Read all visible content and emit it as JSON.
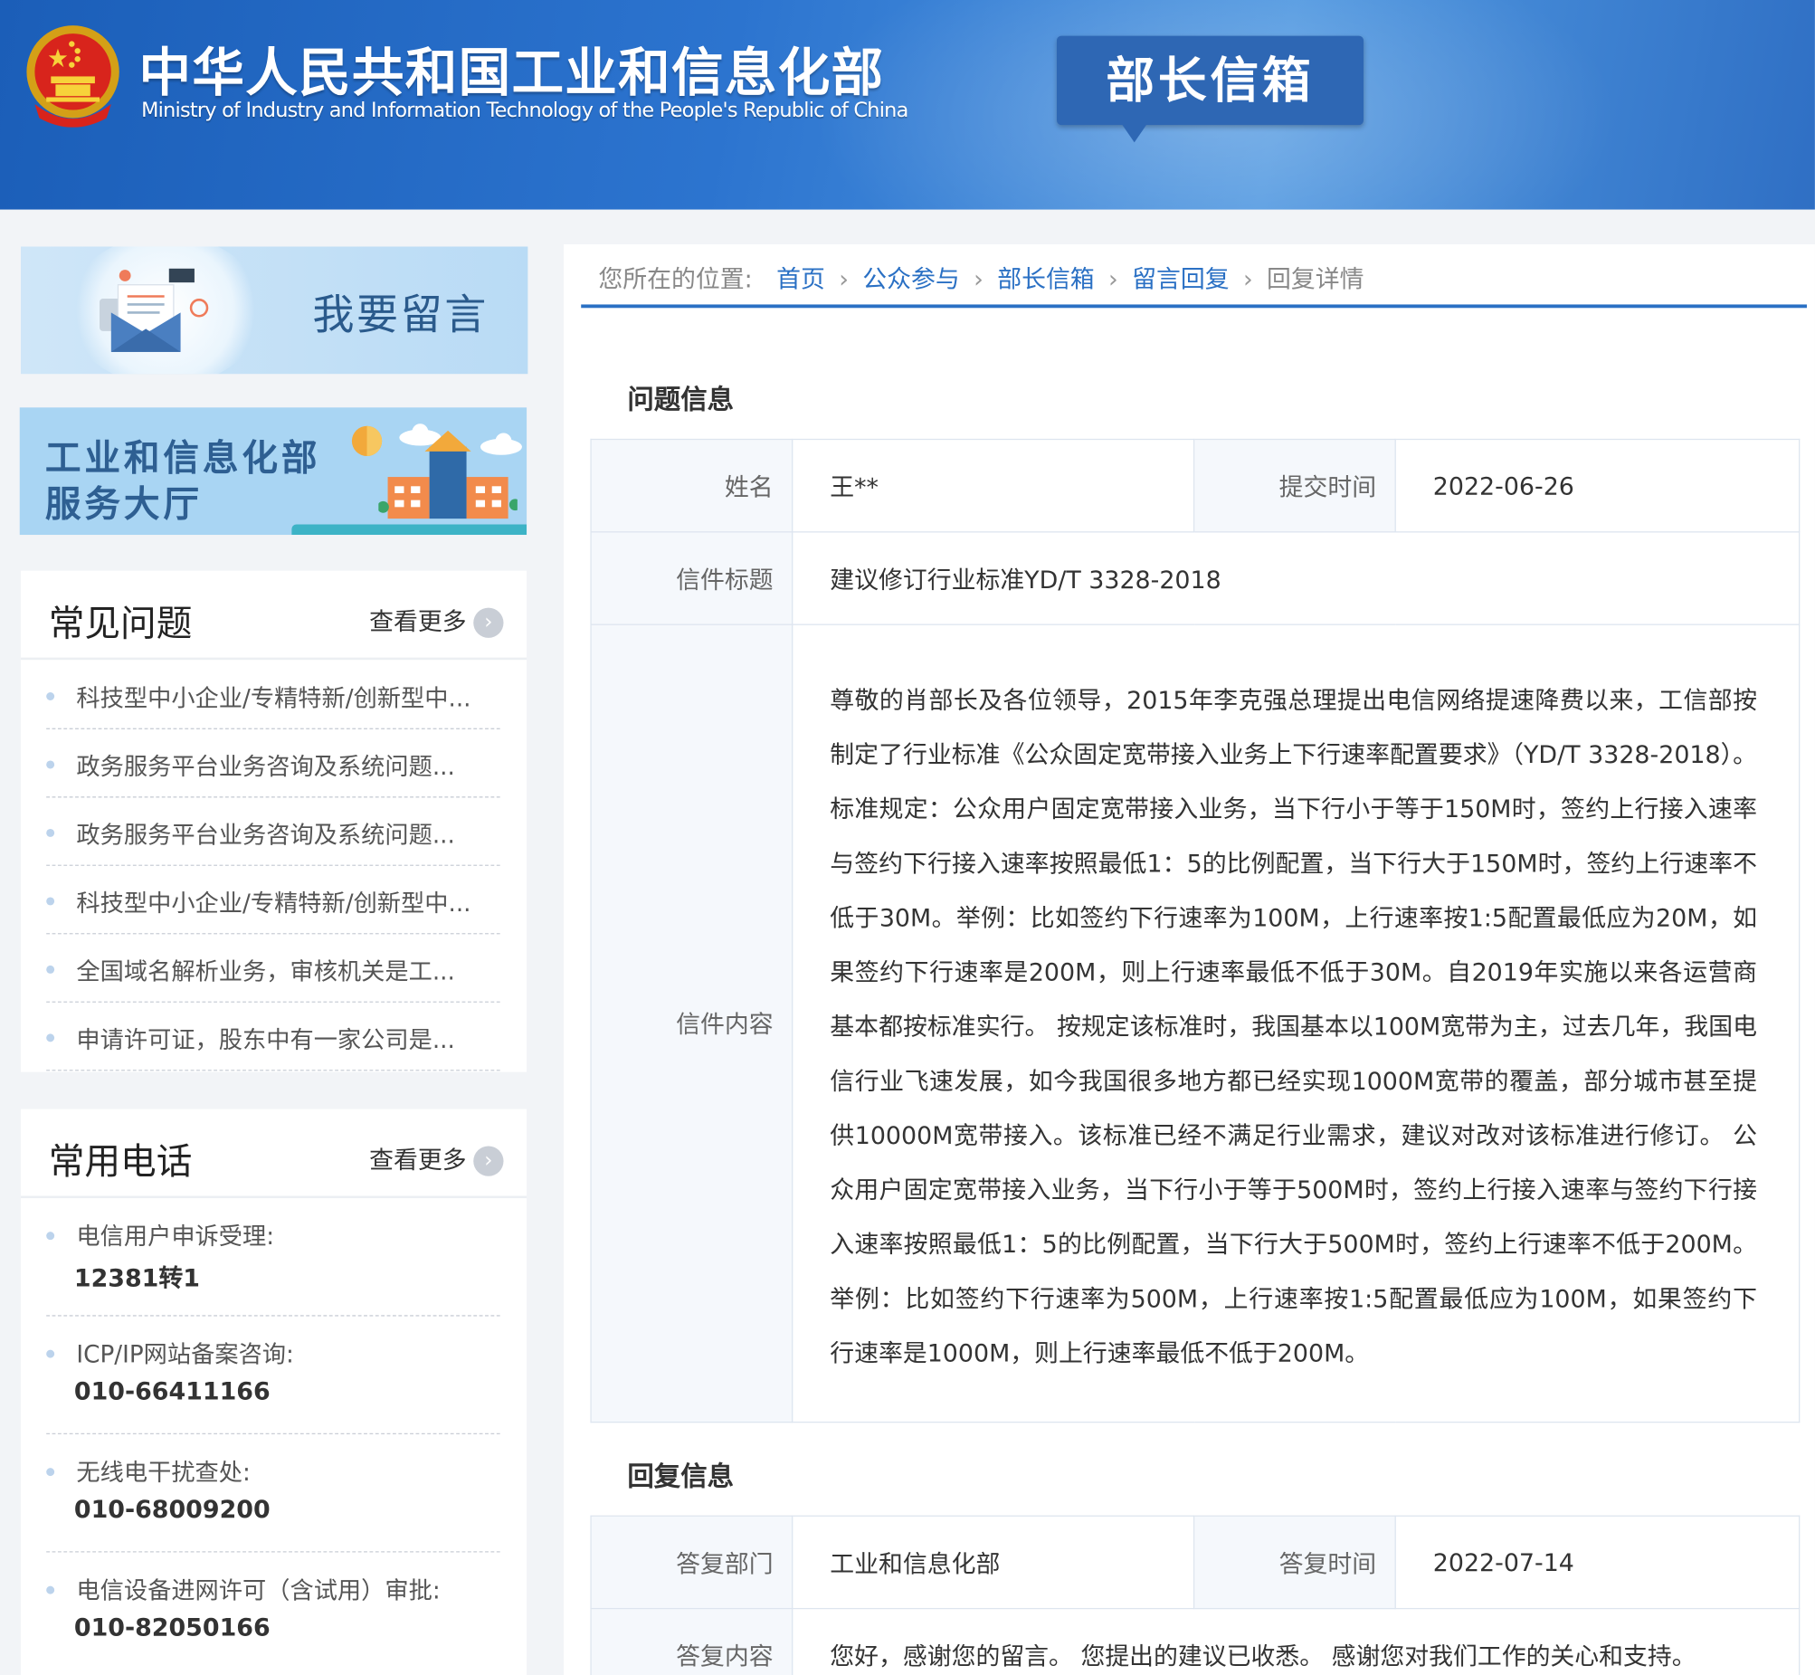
{
  "header": {
    "title_cn": "中华人民共和国工业和信息化部",
    "title_en": "Ministry of Industry and Information Technology of the People's Republic of China",
    "section_badge": "部长信箱"
  },
  "sidebar": {
    "leave_message": "我要留言",
    "service_hall_line1": "工业和信息化部",
    "service_hall_line2": "服务大厅",
    "faq": {
      "title": "常见问题",
      "more": "查看更多",
      "items": [
        "科技型中小企业/专精特新/创新型中...",
        "政务服务平台业务咨询及系统问题...",
        "政务服务平台业务咨询及系统问题...",
        "科技型中小企业/专精特新/创新型中...",
        "全国域名解析业务，审核机关是工...",
        "申请许可证，股东中有一家公司是..."
      ]
    },
    "phones": {
      "title": "常用电话",
      "more": "查看更多",
      "items": [
        {
          "label": "电信用户申诉受理:",
          "number": "12381转1"
        },
        {
          "label": "ICP/IP网站备案咨询:",
          "number": "010-66411166"
        },
        {
          "label": "无线电干扰查处:",
          "number": "010-68009200"
        },
        {
          "label": "电信设备进网许可（含试用）审批:",
          "number": "010-82050166"
        }
      ]
    }
  },
  "breadcrumb": {
    "prefix": "您所在的位置:",
    "items": [
      "首页",
      "公众参与",
      "部长信箱",
      "留言回复"
    ],
    "current": "回复详情"
  },
  "question": {
    "section_title": "问题信息",
    "name_label": "姓名",
    "name_value": "王**",
    "submit_label": "提交时间",
    "submit_value": "2022-06-26",
    "subject_label": "信件标题",
    "subject_value": "建议修订行业标准YD/T 3328-2018",
    "content_label": "信件内容",
    "content_value": "尊敬的肖部长及各位领导，2015年李克强总理提出电信网络提速降费以来，工信部按制定了行业标准《公众固定宽带接入业务上下行速率配置要求》（YD/T 3328-2018）。标准规定：公众用户固定宽带接入业务，当下行小于等于150M时，签约上行接入速率与签约下行接入速率按照最低1：5的比例配置，当下行大于150M时，签约上行速率不低于30M。举例：比如签约下行速率为100M，上行速率按1:5配置最低应为20M，如果签约下行速率是200M，则上行速率最低不低于30M。自2019年实施以来各运营商基本都按标准实行。 按规定该标准时，我国基本以100M宽带为主，过去几年，我国电信行业飞速发展，如今我国很多地方都已经实现1000M宽带的覆盖，部分城市甚至提供10000M宽带接入。该标准已经不满足行业需求，建议对改对该标准进行修订。 公众用户固定宽带接入业务，当下行小于等于500M时，签约上行接入速率与签约下行接入速率按照最低1：5的比例配置，当下行大于500M时，签约上行速率不低于200M。举例：比如签约下行速率为500M，上行速率按1:5配置最低应为100M，如果签约下行速率是1000M，则上行速率最低不低于200M。"
  },
  "reply": {
    "section_title": "回复信息",
    "dept_label": "答复部门",
    "dept_value": "工业和信息化部",
    "time_label": "答复时间",
    "time_value": "2022-07-14",
    "content_label": "答复内容",
    "content_value": "您好，感谢您的留言。 您提出的建议已收悉。 感谢您对我们工作的关心和支持。"
  },
  "colors": {
    "header_blue": "#2c74cf",
    "link_blue": "#2a70c4",
    "badge_blue": "#2e67b4"
  },
  "icons": [
    "national-emblem-icon",
    "envelope-icon",
    "building-icon",
    "sun-icon",
    "cloud-icon",
    "chevron-right-icon"
  ]
}
